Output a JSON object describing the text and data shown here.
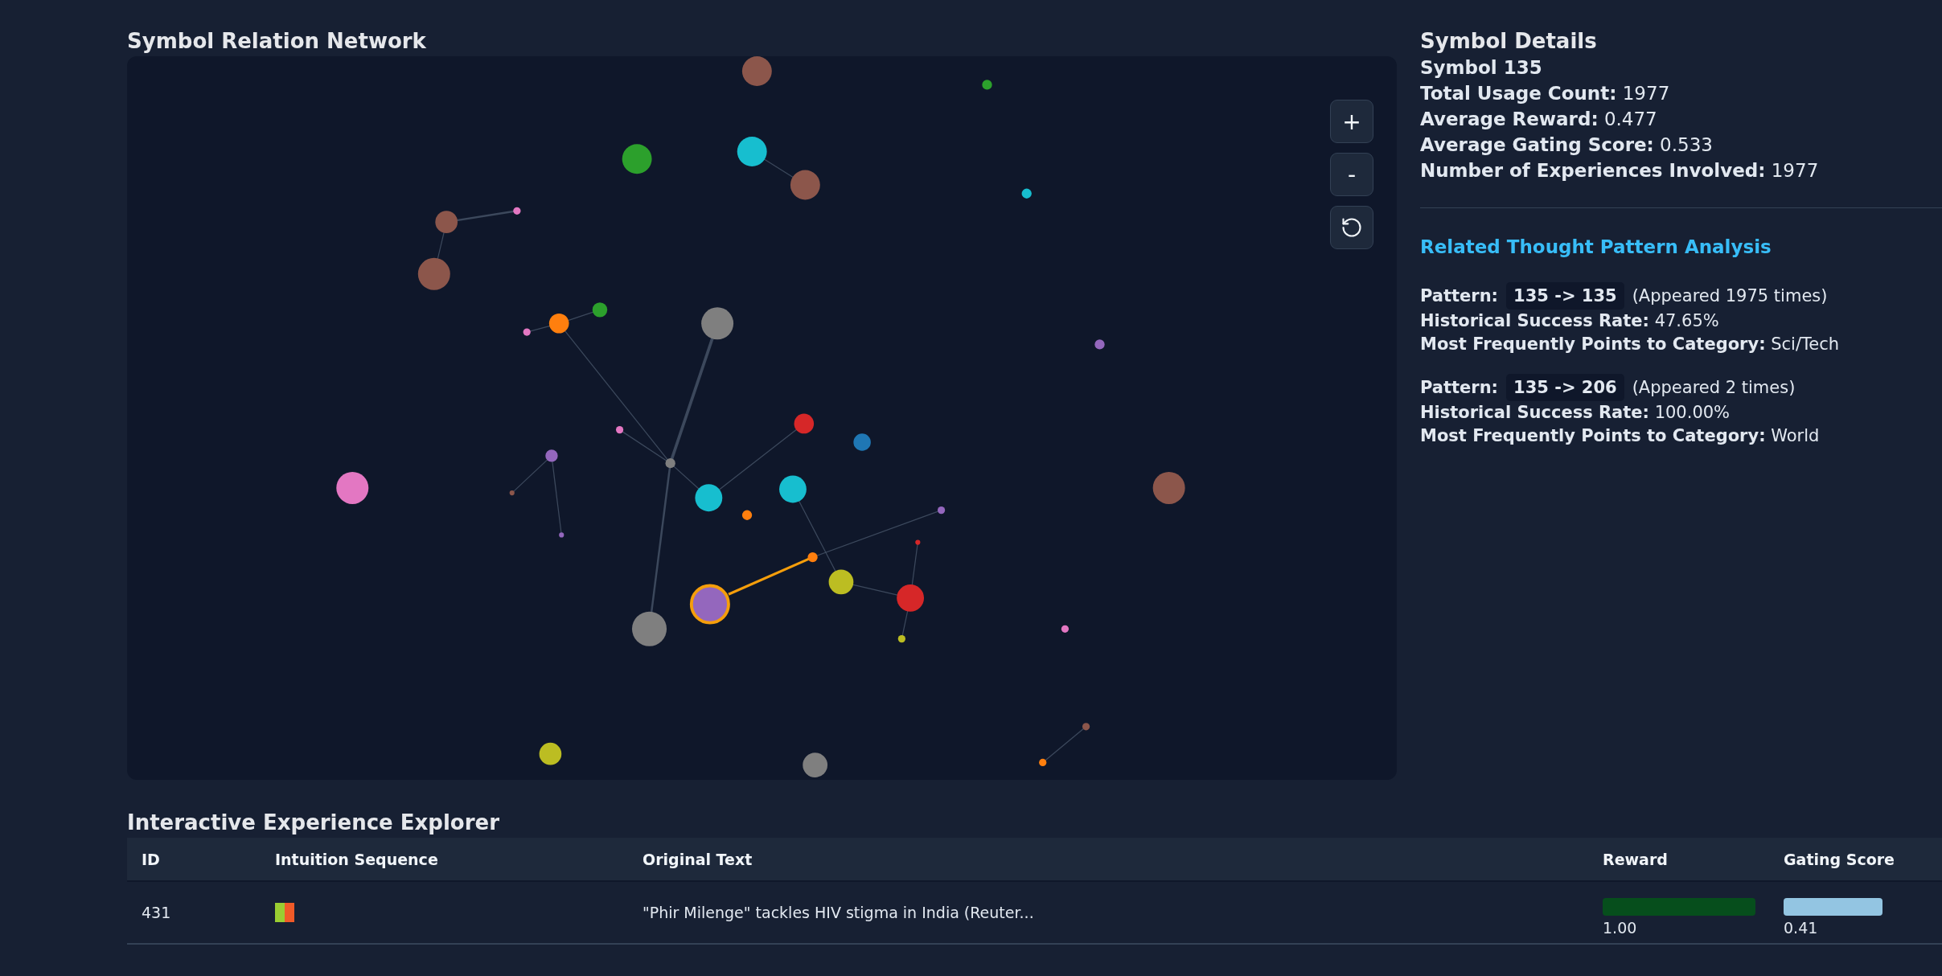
{
  "graph": {
    "title": "Symbol Relation Network",
    "controls": [
      {
        "kind": "zoom_in",
        "label": "+"
      },
      {
        "kind": "zoom_out",
        "label": "-"
      },
      {
        "kind": "reset"
      }
    ]
  },
  "details": {
    "title": "Symbol Details",
    "symbol": "Symbol 135",
    "stats": [
      "**Total Usage Count:** 1977",
      "**Average Reward:** 0.477",
      "**Average Gating Score:** 0.533",
      "**Number of Experiences Involved:** 1977"
    ]
  },
  "analysis": {
    "title": "Related Thought Pattern Analysis",
    "patterns": [
      {
        "label": "Pattern:",
        "sequence": "135 -> 135",
        "appeared": "(Appeared 1975 times)",
        "lines": [
          "**Historical Success Rate:** 47.65%",
          "**Most Frequently Points to Category:** Sci/Tech"
        ]
      },
      {
        "label": "Pattern:",
        "sequence": "135 -> 206",
        "appeared": "(Appeared 2 times)",
        "lines": [
          "**Historical Success Rate:** 100.00%",
          "**Most Frequently Points to Category:** World"
        ]
      }
    ]
  },
  "explorer": {
    "title": "Interactive Experience Explorer",
    "columns": [
      "ID",
      "Intuition Sequence",
      "Original Text",
      "Reward",
      "Gating Score"
    ],
    "rows": [
      {
        "id": "431",
        "sequence": [
          {
            "color": "#9acd32"
          },
          {
            "color": "#f05a28"
          }
        ],
        "text": "\"Phir Milenge\" tackles HIV stigma in India (Reuter...",
        "reward": {
          "value": "1.00"
        },
        "gating": {
          "value": "0.41"
        }
      }
    ]
  }
}
